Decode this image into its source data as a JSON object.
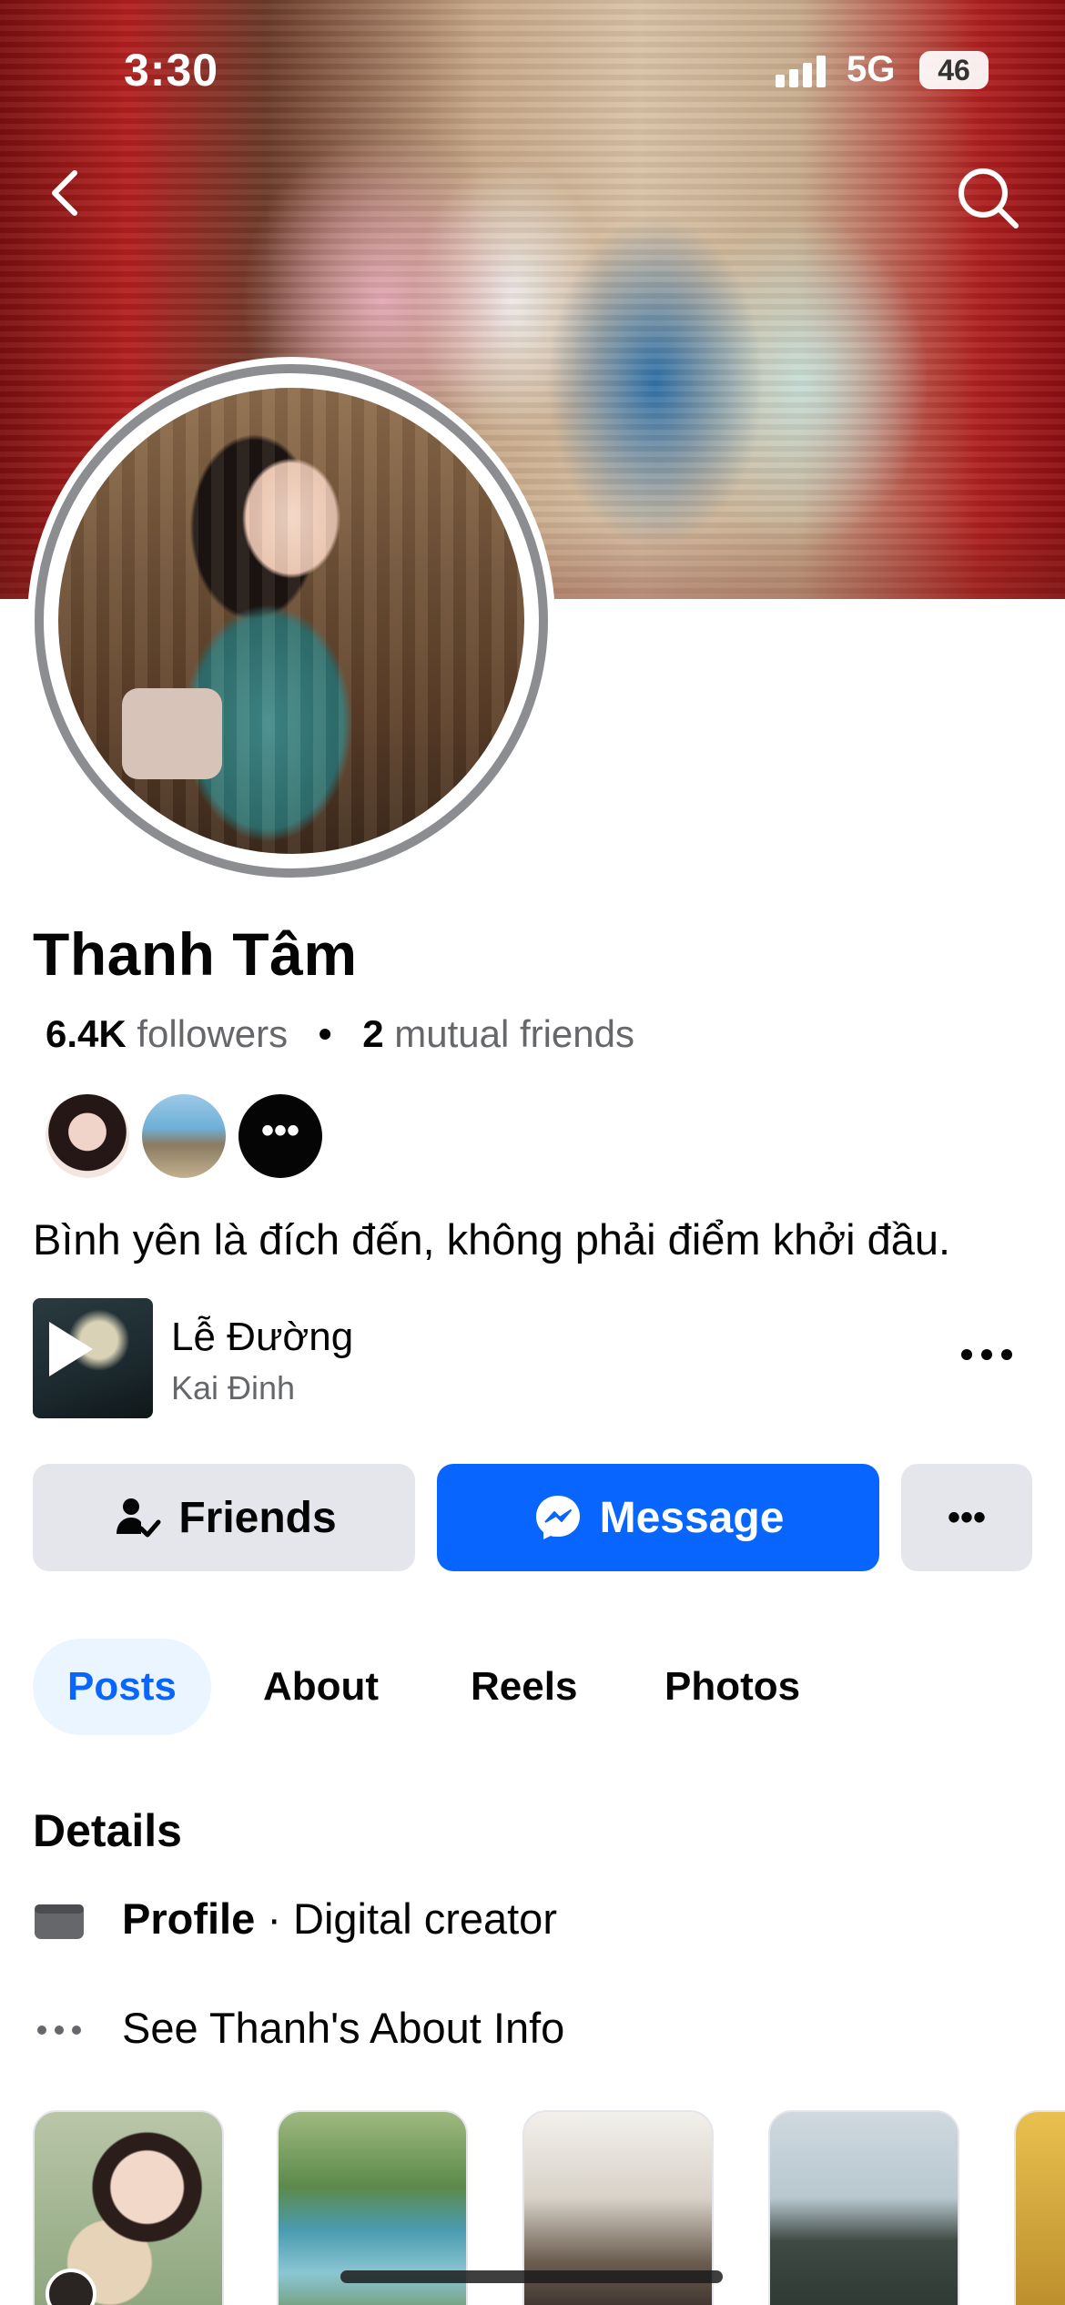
{
  "status_bar": {
    "time": "3:30",
    "network": "5G",
    "battery": "46"
  },
  "profile": {
    "name": "Thanh Tâm",
    "followers_count": "6.4K",
    "followers_label": "followers",
    "mutual_count": "2",
    "mutual_label": "mutual friends",
    "mutual_more": "•••",
    "bio": "Bình yên là đích đến, không phải điểm khởi đầu."
  },
  "music": {
    "title": "Lễ Đường",
    "artist": "Kai Đinh"
  },
  "actions": {
    "friends_label": "Friends",
    "message_label": "Message",
    "more_label": "•••"
  },
  "tabs": [
    {
      "label": "Posts",
      "active": true
    },
    {
      "label": "About",
      "active": false
    },
    {
      "label": "Reels",
      "active": false
    },
    {
      "label": "Photos",
      "active": false
    }
  ],
  "details": {
    "title": "Details",
    "profile_bold": "Profile",
    "profile_rest": " · Digital creator",
    "about_link": "See Thanh's About Info"
  },
  "colors": {
    "accent": "#0866ff",
    "button_gray": "#e4e6eb",
    "secondary_text": "#65676b",
    "active_tab_bg": "#ebf5ff"
  },
  "icons": {
    "back": "chevron-left-icon",
    "search": "search-icon",
    "friends": "person-check-icon",
    "message": "messenger-icon",
    "details_profile": "profile-card-icon",
    "details_more": "ellipsis-icon",
    "music_play": "play-icon"
  }
}
